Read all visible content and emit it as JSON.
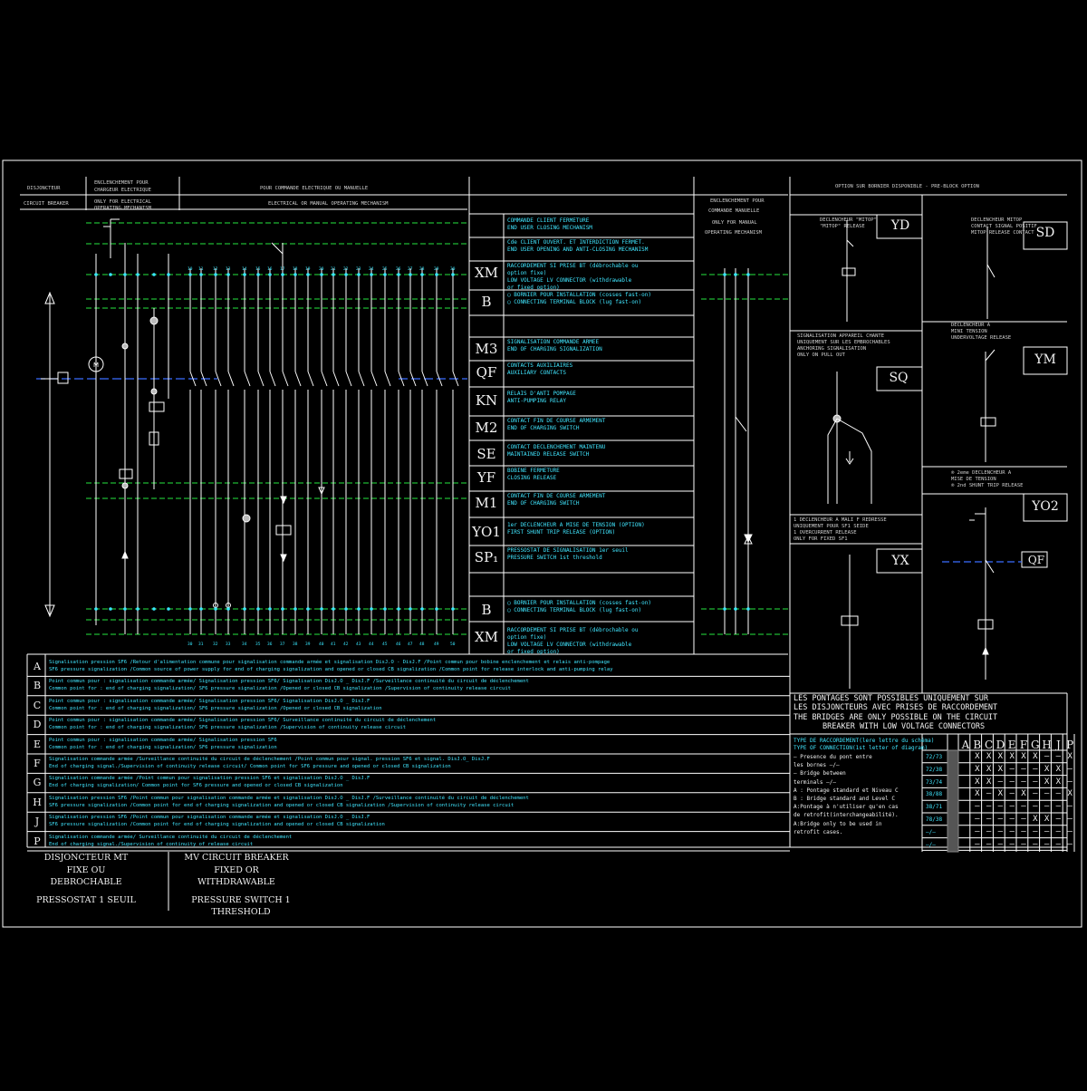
{
  "headers": {
    "disjoncteur": "DISJONCTEUR",
    "circuit_breaker": "CIRCUIT BREAKER",
    "enclenchement": [
      "ENCLENCHEMENT POUR",
      "CHARGEUR ELECTRIQUE",
      "ONLY FOR ELECTRICAL",
      "OPERATING MECHANISM"
    ],
    "commande": "POUR COMMANDE ELECTRIQUE OU MANUELLE",
    "commande_en": "ELECTRICAL OR MANUAL OPERATING MECHANISM",
    "manual": [
      "ENCLENCHEMENT POUR",
      "COMMANDE MANUELLE",
      "ONLY FOR MANUAL",
      "OPERATING MECHANISM"
    ],
    "option": "OPTION SUR BORNIER DISPONIBLE  -  PRE-BLOCK OPTION"
  },
  "legend": [
    {
      "code": "",
      "lines": [
        "COMMANDE CLIENT FERMETURE",
        "END USER CLOSING MECHANISM"
      ]
    },
    {
      "code": "",
      "lines": [
        "Cde CLIENT OUVERT. ET INTERDICTION FERMET.",
        "END USER OPENING AND ANTI-CLOSING MECHANISM"
      ]
    },
    {
      "code": "XM",
      "lines": [
        "RACCORDEMENT SI PRISE BT (débrochable ou",
        "option fixe)",
        "LOW VOLTAGE LV CONNECTOR (withdrawable",
        "or fixed option)"
      ]
    },
    {
      "code": "B",
      "lines": [
        "◯ BORNIER POUR INSTALLATION (cosses fast-on)",
        "◯ CONNECTING TERMINAL BLOCK (lug fast-on)"
      ]
    },
    {
      "code": "M3",
      "lines": [
        "SIGNALISATION COMMANDE ARMEE",
        "END OF CHARGING SIGNALIZATION"
      ]
    },
    {
      "code": "QF",
      "lines": [
        "CONTACTS AUXILIAIRES",
        "AUXILIARY CONTACTS"
      ]
    },
    {
      "code": "KN",
      "lines": [
        "RELAIS D'ANTI POMPAGE",
        "ANTI-PUMPING RELAY"
      ]
    },
    {
      "code": "M2",
      "lines": [
        "CONTACT FIN DE COURSE ARMEMENT",
        "END OF CHARGING SWITCH"
      ]
    },
    {
      "code": "SE",
      "lines": [
        "CONTACT DECLENCHEMENT MAINTENU",
        "MAINTAINED RELEASE SWITCH"
      ]
    },
    {
      "code": "YF",
      "lines": [
        "BOBINE FERMETURE",
        "CLOSING RELEASE"
      ]
    },
    {
      "code": "M1",
      "lines": [
        "CONTACT FIN DE COURSE ARMEMENT",
        "END OF CHARGING SWITCH"
      ]
    },
    {
      "code": "YO1",
      "lines": [
        "1er DECLENCHEUR A MISE DE TENSION (OPTION)",
        "FIRST SHUNT TRIP RELEASE (OPTION)"
      ]
    },
    {
      "code": "SP₁",
      "lines": [
        "PRESSOSTAT DE SIGNALISATION  1er seuil",
        "PRESSURE SWITCH 1st threshold"
      ]
    },
    {
      "code": "",
      "lines": []
    },
    {
      "code": "B",
      "lines": [
        "◯ BORNIER POUR INSTALLATION (cosses fast-on)",
        "◯ CONNECTING TERMINAL BLOCK (lug fast-on)"
      ]
    },
    {
      "code": "XM",
      "lines": [
        "RACCORDEMENT SI PRISE BT (débrochable ou",
        "option fixe)",
        "LOW VOLTAGE LV CONNECTOR (withdrawable",
        "or fixed option)"
      ]
    }
  ],
  "options": [
    {
      "code": "YD",
      "lines": [
        "DECLENCHEUR \"MITOP\"",
        "\"MITOP\" RELEASE"
      ]
    },
    {
      "code": "SD",
      "lines": [
        "DECLENCHEUR MITOP",
        "CONTACT SIGNAL POSITIF",
        "MITOP RELEASE CONTACT"
      ]
    },
    {
      "code": "SQ",
      "lines": [
        "SIGNALISATION APPAREIL CHANTE",
        "UNIQUEMENT SUR LES EMBROCHABLES",
        "ANCHORING SIGNALISATION",
        "ONLY ON PULL OUT"
      ]
    },
    {
      "code": "YM",
      "lines": [
        "DECLENCHEUR A",
        "MINI TENSION",
        "UNDERVOLTAGE RELEASE"
      ]
    },
    {
      "code": "YO2",
      "lines": [
        "® 2eme DECLENCHEUR A",
        "MISE DE TENSION",
        "® 2nd SHUNT TRIP RELEASE"
      ]
    },
    {
      "code": "YX",
      "lines": [
        "1 DECLENCHEUR A MALI F REDRESSE",
        "UNIQUEMENT POUR SF1 SEIDE",
        "1 OVERCURRENT RELEASE",
        "ONLY FOR FIXED SF1"
      ]
    }
  ],
  "qf_label": "QF",
  "rows": [
    {
      "letter": "A",
      "lines": [
        "Signalisation pression SF6      /Retour d'alimentation commune pour signalisation commande armée et signalisation DisJ.O - DisJ.F          /Point commun pour bobine enclenchement et relais anti-pompage",
        "SF6 pressure signalization      /Common source of power supply for end of charging signalization and opened or closed CB signalization          /Common point for release interlock and anti-pumping relay"
      ]
    },
    {
      "letter": "B",
      "lines": [
        "Point commun pour : signalisation commande armée/ Signalisation pression SF6/            Signalisation DisJ.O _ DisJ.F     /Surveillance continuité du circuit de déclenchement",
        "Common point for : end of charging signalization/ SF6 pressure signalization               /Opened or closed CB signalization       /Supervision of continuity release circuit"
      ]
    },
    {
      "letter": "C",
      "lines": [
        "Point commun pour : signalisation commande armée/ Signalisation pression SF6/            Signalisation DisJ.O _ DisJ.F",
        "Common point for : end of charging signalization/ SF6 pressure signalization               /Opened or closed CB signalization"
      ]
    },
    {
      "letter": "D",
      "lines": [
        "Point commun pour : signalisation commande armée/ Signalisation pression SF6/            Surveillance continuité du circuit de déclenchement",
        "Common point for : end of charging signalization/ SF6 pressure signalization               /Supervision of continuity release circuit"
      ]
    },
    {
      "letter": "E",
      "lines": [
        "Point commun pour : signalisation commande armée/ Signalisation pression SF6",
        "Common point for : end of charging signalization/ SF6 pressure signalization"
      ]
    },
    {
      "letter": "F",
      "lines": [
        "Signalisation commande armée        /Surveillance continuité du circuit de déclenchement          /Point commun pour signal. pression SF6 et signal. DisJ.O_ DisJ.F",
        "End of charging signal./Supervision of continuity release circuit/              Common point for SF6 pressure and opened or closed CB signalization"
      ]
    },
    {
      "letter": "G",
      "lines": [
        "Signalisation commande armée           /Point commun pour signalisation pression SF6 et signalisation DisJ.O _ DisJ.F",
        "End of charging signalization/          Common point for SF6 pressure and opened or closed CB signalization"
      ]
    },
    {
      "letter": "H",
      "lines": [
        "Signalisation pression SF6       /Point commun pour signalisation commande armée et signalisation DisJ.O _ DisJ.F          /Surveillance continuité du circuit de déclenchement",
        "SF6 pressure signalization       /Common point for end of charging signalization and opened or closed CB signalization          /Supervision of continuity release circuit"
      ]
    },
    {
      "letter": "J",
      "lines": [
        "Signalisation pression SF6       /Point commun pour signalisation commande armée et signalisation DisJ.O _ DisJ.F",
        "SF6 pressure signalization       /Common point for end of charging signalization and opened or closed CB signalization"
      ]
    },
    {
      "letter": "P",
      "lines": [
        "Signalisation commande armée/ Surveillance continuité du circuit de déclenchement",
        "End of charging signal./Supervision of continuity of release circuit"
      ]
    }
  ],
  "bridges_note": [
    "LES PONTAGES SONT POSSIBLES UNIQUEMENT SUR",
    "LES DISJONCTEURS AVEC PRISES DE RACCORDEMENT",
    "THE BRIDGES ARE ONLY POSSIBLE ON THE CIRCUIT",
    "BREAKER WITH LOW VOLTAGE CONNECTORS"
  ],
  "table": {
    "title_lines": [
      "TYPE DE RACCORDEMENT(lere lettre du schéma)",
      "TYPE OF CONNECTION(1st letter of diagram)"
    ],
    "notes": [
      "– Presence du pont entre",
      "   les bornes  —/—",
      "– Bridge between",
      "   terminals  —/—",
      "A : Pontage standard        et Niveau C",
      "B : Bridge standard         and Level C",
      "A:Pontage à n'utiliser qu'en cas",
      "de retrofit(interchangeabilité).",
      "A:Bridge only to be used in",
      "retrofit cases."
    ],
    "columns": [
      "A",
      "B",
      "C",
      "D",
      "E",
      "F",
      "G",
      "H",
      "J",
      "P"
    ],
    "rows": [
      {
        "type": "72/73",
        "cells": [
          "",
          "X",
          "X",
          "X",
          "X",
          "X",
          "X",
          "–",
          "–",
          "X"
        ]
      },
      {
        "type": "72/38",
        "cells": [
          "",
          "X",
          "X",
          "X",
          "–",
          "–",
          "–",
          "X",
          "X",
          "–"
        ]
      },
      {
        "type": "73/74",
        "cells": [
          "",
          "X",
          "X",
          "–",
          "–",
          "–",
          "–",
          "X",
          "X",
          "–"
        ]
      },
      {
        "type": "38/88",
        "cells": [
          "",
          "X",
          "–",
          "X",
          "–",
          "X",
          "–",
          "–",
          "–",
          "X"
        ]
      },
      {
        "type": "38/71",
        "cells": [
          "",
          "–",
          "–",
          "–",
          "–",
          "–",
          "–",
          "–",
          "–",
          "–"
        ]
      },
      {
        "type": "78/38",
        "cells": [
          "",
          "–",
          "–",
          "–",
          "–",
          "–",
          "X",
          "X",
          "–",
          "–"
        ]
      },
      {
        "type": "—/—",
        "cells": [
          "",
          "–",
          "–",
          "–",
          "–",
          "–",
          "–",
          "–",
          "–",
          "–"
        ]
      },
      {
        "type": "—/—",
        "cells": [
          "",
          "–",
          "–",
          "–",
          "–",
          "–",
          "–",
          "–",
          "–",
          "–"
        ]
      }
    ]
  },
  "title_fr": [
    "DISJONCTEUR MT",
    "FIXE OU",
    "DEBROCHABLE",
    "PRESSOSTAT 1 SEUIL"
  ],
  "title_en": [
    "MV CIRCUIT BREAKER",
    "FIXED OR",
    "WITHDRAWABLE",
    "PRESSURE SWITCH 1 THRESHOLD"
  ],
  "colors": {
    "background": "#000000",
    "lines": "#ffffff",
    "wire": "#26e640",
    "cyan": "#38e8ff",
    "blue": "#3a6cff"
  }
}
